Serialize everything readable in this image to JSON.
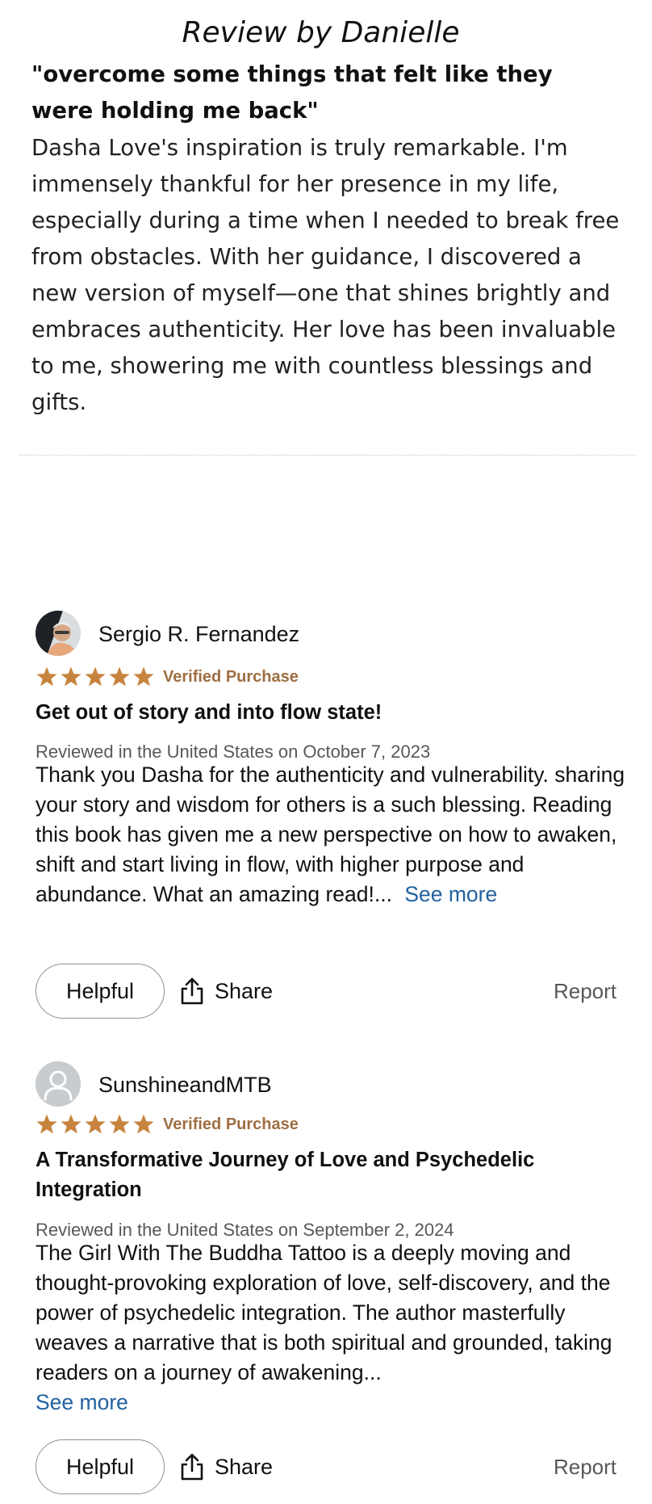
{
  "feature": {
    "title": "Review by Danielle",
    "quote": "\"overcome some things that felt like they were holding me back\"",
    "body": "Dasha Love's inspiration is truly remarkable. I'm immensely thankful for her presence in my life, especially during a time when I needed to break free from obstacles. With her guidance, I discovered a new version of myself—one that shines brightly and embraces authenticity. Her love has been invaluable to me, showering me with countless blessings and gifts."
  },
  "reviews": [
    {
      "name": "Sergio R. Fernandez",
      "rating": 5,
      "verified": "Verified Purchase",
      "headline": "Get out of story and into flow state!",
      "meta": "Reviewed in the United States on October 7, 2023",
      "body": "Thank you Dasha for the authenticity and vulnerability. sharing your story and wisdom for others is a such blessing. Reading this book has given me a new perspective on how to awaken, shift and start living in flow, with higher purpose and abundance. What an amazing read!...",
      "see_more": "See more",
      "helpful": "Helpful",
      "share": "Share",
      "report": "Report"
    },
    {
      "name": "SunshineandMTB",
      "rating": 5,
      "verified": "Verified Purchase",
      "headline": "A Transformative Journey of Love and Psychedelic Integration",
      "meta": "Reviewed in the United States on September 2, 2024",
      "body": "The Girl With The Buddha Tattoo is a deeply moving and thought-provoking exploration of love, self-discovery, and the power of psychedelic integration. The author masterfully weaves a narrative that is both spiritual and grounded, taking readers on a journey of awakening...",
      "see_more": "See more",
      "helpful": "Helpful",
      "share": "Share",
      "report": "Report"
    }
  ],
  "colors": {
    "star": "#c7843e",
    "verified": "#b06b2c",
    "link": "#2162a1",
    "muted": "#565959"
  }
}
